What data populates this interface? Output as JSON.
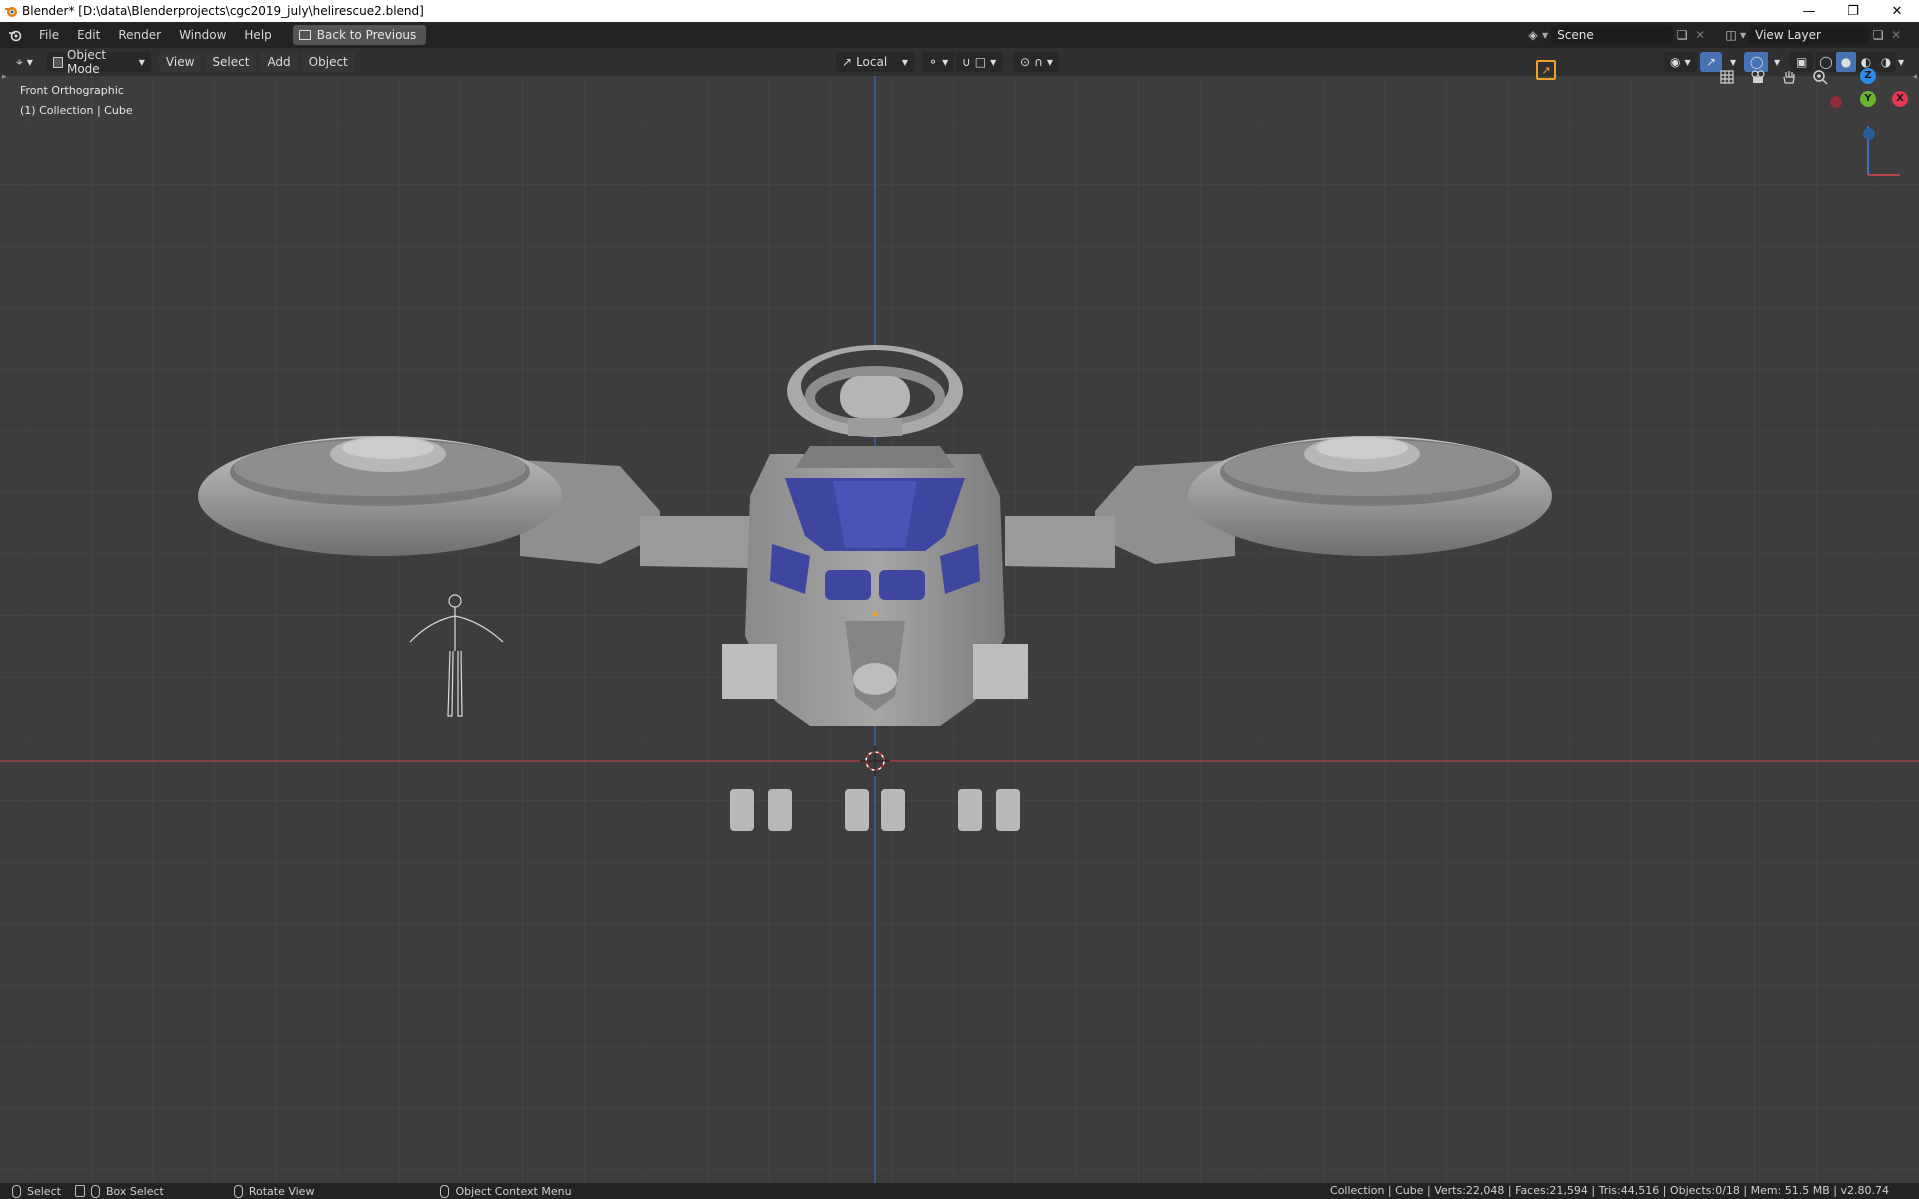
{
  "window": {
    "title": "Blender* [D:\\data\\Blenderprojects\\cgc2019_july\\helirescue2.blend]",
    "controls": [
      "minimize",
      "restore",
      "close"
    ]
  },
  "topbar": {
    "menus": [
      "File",
      "Edit",
      "Render",
      "Window",
      "Help"
    ],
    "back_button": "Back to Previous",
    "scene_label": "Scene",
    "view_layer_label": "View Layer"
  },
  "viewport_header": {
    "mode": "Object Mode",
    "menus": [
      "View",
      "Select",
      "Add",
      "Object"
    ],
    "transform_orientation": "Local"
  },
  "viewport": {
    "view_name": "Front Orthographic",
    "collection_info": "(1) Collection | Cube",
    "gizmo_axes": {
      "x": "X",
      "y": "Y",
      "z": "Z"
    }
  },
  "statusbar": {
    "select": "Select",
    "box_select": "Box Select",
    "rotate_view": "Rotate View",
    "context_menu": "Object Context Menu",
    "stats": "Collection | Cube | Verts:22,048 | Faces:21,594 | Tris:44,516 | Objects:0/18 | Mem: 51.5 MB | v2.80.74"
  },
  "colors": {
    "viewport_bg": "#3d3d3d",
    "grid": "#4a4a4a",
    "x_axis": "#b5454b",
    "z_axis": "#3e6fc7",
    "model": "#9b9b9b",
    "glass": "#3e46a0",
    "accent": "#f3a02c"
  }
}
